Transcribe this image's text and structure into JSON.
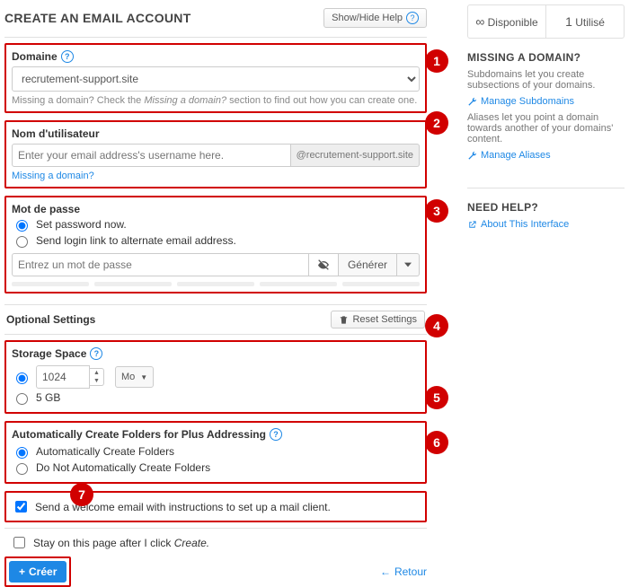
{
  "header": {
    "title": "CREATE AN EMAIL ACCOUNT",
    "helpBtn": "Show/Hide Help"
  },
  "domain": {
    "label": "Domaine",
    "value": "recrutement-support.site",
    "hint_pre": "Missing a domain? Check the ",
    "hint_em": "Missing a domain?",
    "hint_post": " section to find out how you can create one."
  },
  "username": {
    "label": "Nom d'utilisateur",
    "placeholder": "Enter your email address's username here.",
    "suffix": "@recrutement-support.site",
    "missing": "Missing a domain?"
  },
  "password": {
    "label": "Mot de passe",
    "opt_now": "Set password now.",
    "opt_link": "Send login link to alternate email address.",
    "placeholder": "Entrez un mot de passe",
    "generate": "Générer"
  },
  "optional": {
    "label": "Optional Settings",
    "reset": "Reset Settings"
  },
  "storage": {
    "label": "Storage Space",
    "value": "1024",
    "unit": "Mo",
    "alt": "5 GB"
  },
  "folders": {
    "label": "Automatically Create Folders for Plus Addressing",
    "opt_auto": "Automatically Create Folders",
    "opt_no": "Do Not Automatically Create Folders"
  },
  "welcome": {
    "label": "Send a welcome email with instructions to set up a mail client."
  },
  "stay": {
    "label_pre": "Stay on this page after I click ",
    "label_em": "Create."
  },
  "footer": {
    "create": "Créer",
    "back": "Retour"
  },
  "side": {
    "avail": "Disponible",
    "used": "Utilisé",
    "used_n": "1",
    "missing_title": "MISSING A DOMAIN?",
    "sub_text": "Subdomains let you create subsections of your domains.",
    "sub_link": "Manage Subdomains",
    "alias_text": "Aliases let you point a domain towards another of your domains' content.",
    "alias_link": "Manage Aliases",
    "help_title": "NEED HELP?",
    "about": "About This Interface"
  },
  "callouts": [
    "1",
    "2",
    "3",
    "4",
    "5",
    "6",
    "7"
  ]
}
